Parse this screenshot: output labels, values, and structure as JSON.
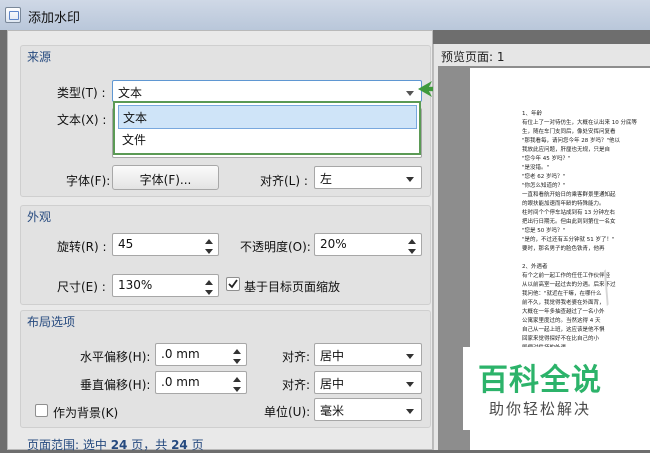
{
  "window": {
    "title": "添加水印"
  },
  "source": {
    "section_title": "来源",
    "type_label": "类型(T) :",
    "type_value": "文本",
    "type_options": [
      "文本",
      "文件"
    ],
    "text_label": "文本(X) :",
    "font_label": "字体(F):",
    "font_button": "字体(F)...",
    "align_label": "对齐(L) :",
    "align_value": "左"
  },
  "appearance": {
    "section_title": "外观",
    "rotation_label": "旋转(R) :",
    "rotation_value": "45",
    "opacity_label": "不透明度(O):",
    "opacity_value": "20%",
    "size_label": "尺寸(E) :",
    "size_value": "130%",
    "scale_checkbox_label": "基于目标页面缩放",
    "scale_checked": true
  },
  "layout": {
    "section_title": "布局选项",
    "h_offset_label": "水平偏移(H):",
    "h_offset_value": ".0 mm",
    "h_align_label": "对齐:",
    "h_align_value": "居中",
    "v_offset_label": "垂直偏移(H):",
    "v_offset_value": ".0 mm",
    "v_align_label": "对齐:",
    "v_align_value": "居中",
    "background_label": "作为背景(K)",
    "background_checked": false,
    "unit_label": "单位(U):",
    "unit_value": "毫米"
  },
  "page_range": {
    "label": "页面范围: 选中",
    "selected": "24",
    "mid": "页，共",
    "total": "24",
    "suffix": "页"
  },
  "preview": {
    "title": "预览页面: 1",
    "lines": [
      "1、年龄",
      "有位上了一对待仿生，大概在认出来 10 分底等",
      "生，随在车门支同后，像处安挥问复看",
      "\"那我看每，请问您今年 28 岁吗？\"他以",
      "我放此应问题，肝厘也无规，只是自",
      "\"您今年 45 岁吗？\"",
      "\"是没错。\"",
      "\"您老 62 岁吗？\"",
      "\"你怎么知道的？\"",
      "一直和看航开始日的乘客群景里通知起",
      "的眼扶能加速而年龄的特殊能力。",
      "柱时间个个停车站成到有 13 分钟左右",
      "把出行日期无。但由此到到第位一名女",
      "\"您是 50 岁吗？\"",
      "\"是的，不过还有五分钟就 51 岁了！\"",
      "要时，那名男子的脸色铁青，他再",
      "",
      "2、外遇者",
      "有个之前一起工作的任任工作伙伴经",
      "从以前高室一起过去的分遇。后来不过",
      "我问他：\"就近在干嘛，在哪什么",
      "前不久，我觉得我老婆在外面背，",
      "大概在一年多抽查越过了一名小外",
      "公寓家里度过的。当然这得 4 天",
      "自己从一起上班，这应该是他不惧",
      "回家来觉得探好不在比自己的小",
      "即便对件坏的外遇。。"
    ]
  },
  "brand": {
    "name": "百科全说",
    "slogan": "助你轻松解决"
  }
}
